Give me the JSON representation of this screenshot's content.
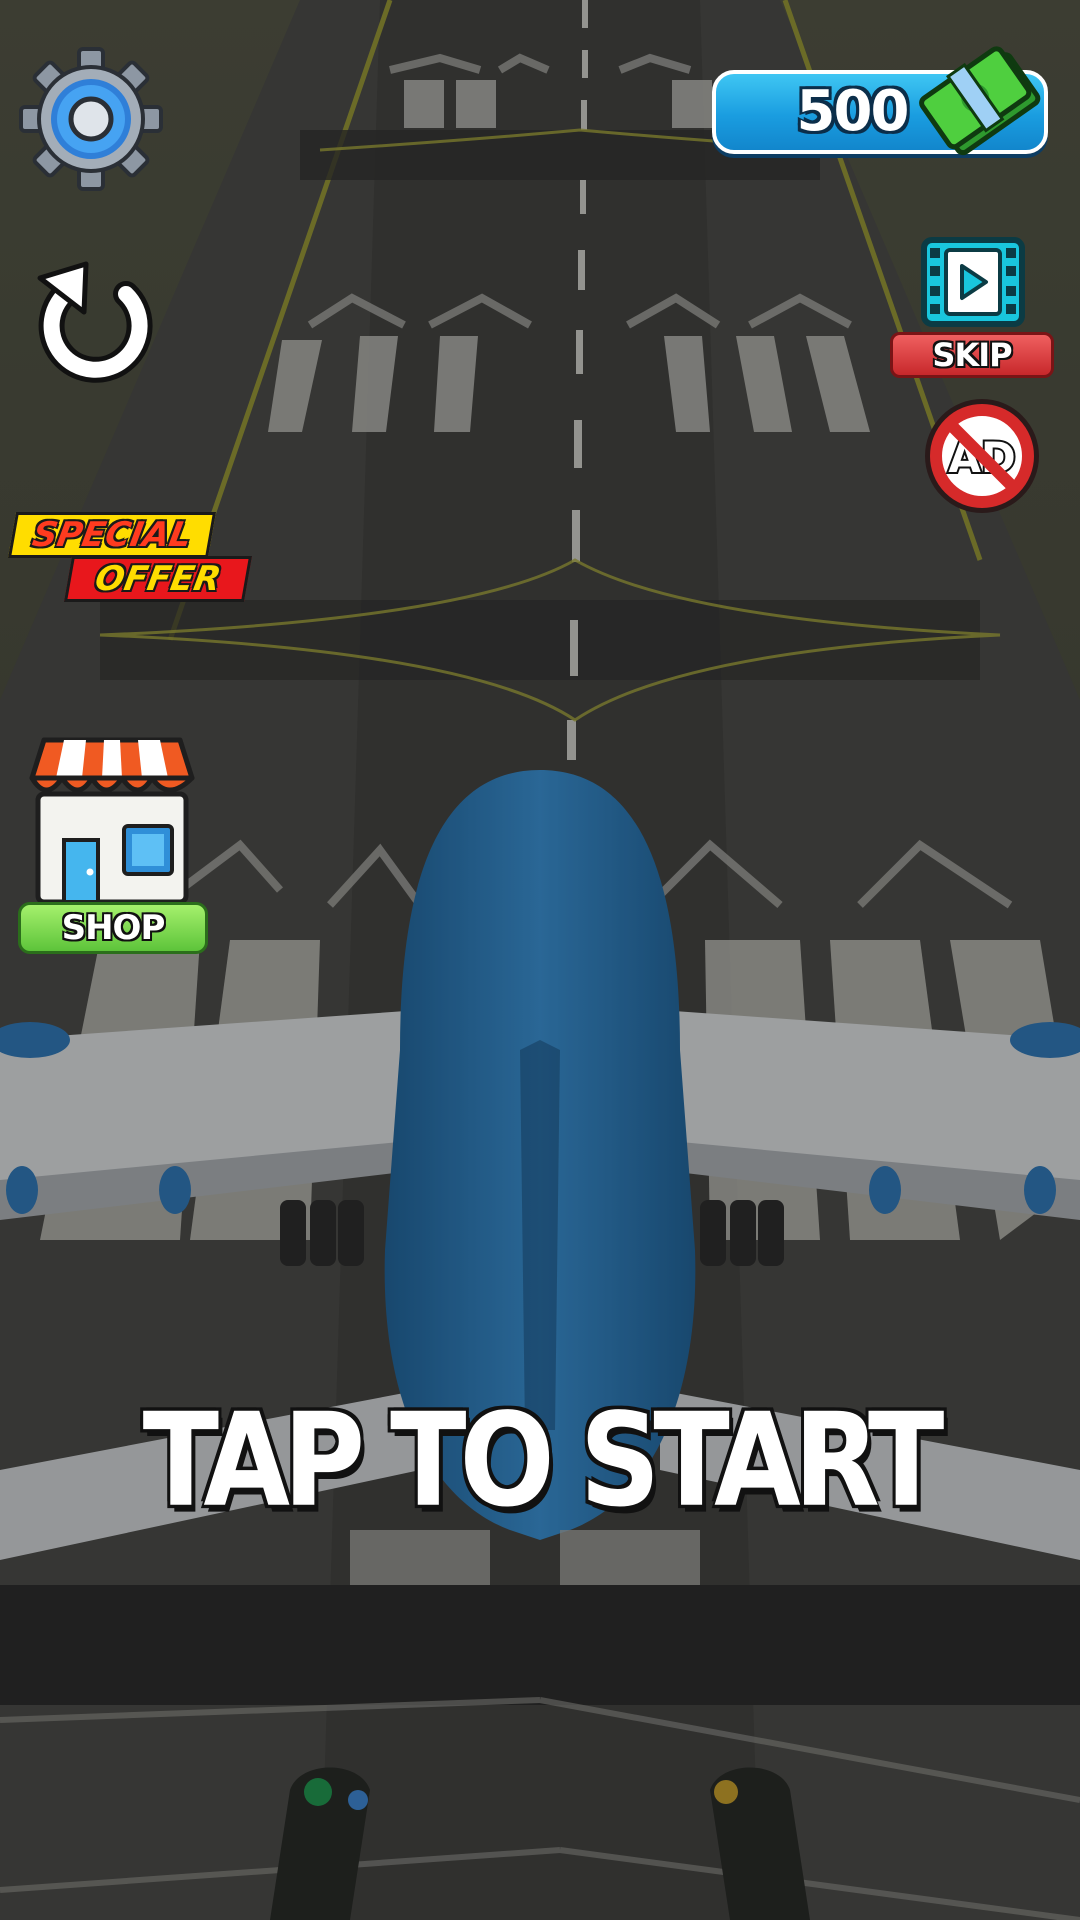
{
  "hud": {
    "currency": {
      "amount": "500",
      "icon": "cash-stack-icon",
      "bar_color": "#1a9de0"
    },
    "settings": {
      "icon": "gear-icon"
    },
    "restart": {
      "icon": "restart-icon"
    },
    "skip": {
      "icon": "video-film-icon",
      "label": "SKIP",
      "color": "#e0393b"
    },
    "no_ads": {
      "icon": "no-ads-icon",
      "badge_text": "AD"
    },
    "special_offer": {
      "line1": "SPECIAL",
      "line2": "OFFER"
    },
    "shop": {
      "icon": "store-icon",
      "label": "SHOP",
      "color": "#6fd44a"
    }
  },
  "prompt": {
    "text": "TAP TO START"
  },
  "scene": {
    "description_icons": [
      "runway",
      "airplane"
    ],
    "plane_color": "#2f77b0"
  }
}
